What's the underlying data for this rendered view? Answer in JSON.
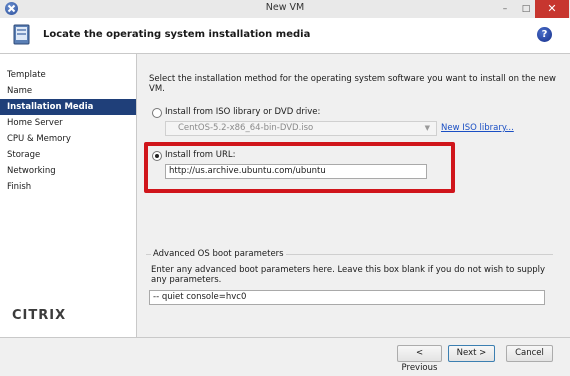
{
  "window": {
    "title": "New VM",
    "minimize": "–",
    "maximize": "□",
    "close": "✕"
  },
  "header": {
    "title": "Locate the operating system installation media",
    "help": "?"
  },
  "nav": {
    "items": [
      {
        "label": "Template"
      },
      {
        "label": "Name"
      },
      {
        "label": "Installation Media",
        "active": true
      },
      {
        "label": "Home Server"
      },
      {
        "label": "CPU & Memory"
      },
      {
        "label": "Storage"
      },
      {
        "label": "Networking"
      },
      {
        "label": "Finish"
      }
    ],
    "logo_text": "CITRIX"
  },
  "main": {
    "instruction": "Select the installation method for the operating system software you want to install on the new VM.",
    "iso_option": {
      "label": "Install from ISO library or DVD drive:",
      "selected": false
    },
    "iso_select": {
      "value": "CentOS-5.2-x86_64-bin-DVD.iso"
    },
    "new_iso_link": "New ISO library...",
    "url_option": {
      "label": "Install from URL:",
      "selected": true
    },
    "url_field": {
      "value": "http://us.archive.ubuntu.com/ubuntu"
    },
    "advanced": {
      "legend": "Advanced OS boot parameters",
      "description": "Enter any advanced boot parameters here. Leave this box blank if you do not wish to supply any parameters.",
      "value": "-- quiet console=hvc0"
    }
  },
  "footer": {
    "previous": "< Previous",
    "next": "Next >",
    "cancel": "Cancel"
  },
  "colors": {
    "nav_active": "#1f3f79",
    "highlight": "#d0151b",
    "link": "#1a4fc4",
    "close": "#c7362f"
  }
}
